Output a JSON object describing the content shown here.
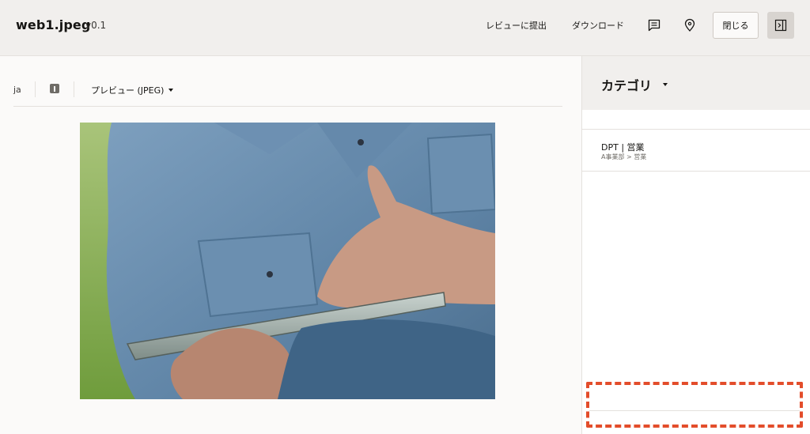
{
  "header": {
    "file_name": "web1.jpeg",
    "version": "v0.1",
    "review_label": "レビューに提出",
    "download_label": "ダウンロード",
    "close_label": "閉じる",
    "icons": [
      "comment-icon",
      "location-pin-icon",
      "collapse-panel-icon"
    ]
  },
  "toolbar": {
    "language": "ja",
    "preview_label": "プレビュー (JPEG)"
  },
  "category_panel": {
    "title": "カテゴリ",
    "items": [
      {
        "name": "DPT | 営業",
        "path": "A事業部 > 営業"
      }
    ]
  },
  "colors": {
    "header_bg": "#f1efed",
    "accent_dashed": "#e34d2b",
    "panel_button_bg": "#d8d4d0"
  }
}
